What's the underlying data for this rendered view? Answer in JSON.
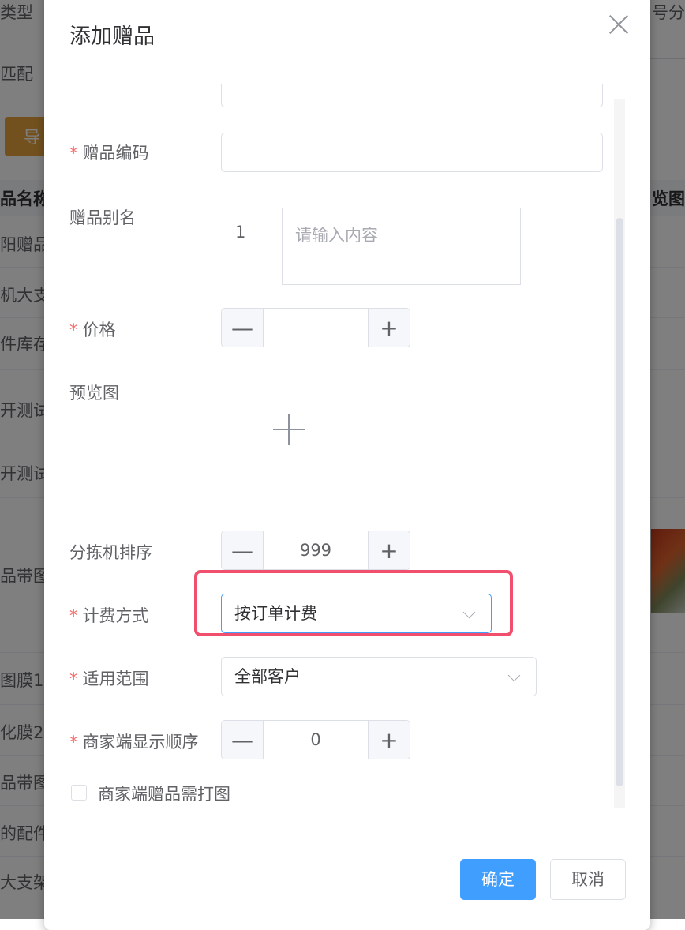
{
  "background": {
    "filter_label_type": "类型",
    "filter_label_match": "匹配",
    "filter_label_right": "号分",
    "export_button": "导",
    "col_name_header": "品名称",
    "col_preview_header": "览图",
    "rows": [
      "阳赠品",
      "机大支",
      "件库存",
      "开测试",
      "开测试",
      "品带图",
      "图膜1",
      "化膜2",
      "品带图",
      "的配件",
      "大支架"
    ]
  },
  "dialog": {
    "title": "添加赠品",
    "fields": {
      "code": {
        "label": "赠品编码",
        "value": ""
      },
      "alias": {
        "label": "赠品别名",
        "index": "1",
        "placeholder": "请输入内容"
      },
      "price": {
        "label": "价格",
        "value": ""
      },
      "preview": {
        "label": "预览图"
      },
      "sort_order": {
        "label": "分拣机排序",
        "value": "999"
      },
      "billing": {
        "label": "计费方式",
        "value": "按订单计费"
      },
      "scope": {
        "label": "适用范围",
        "value": "全部客户"
      },
      "merchant_order": {
        "label": "商家端显示顺序",
        "value": "0"
      },
      "need_print": {
        "label": "商家端赠品需打图",
        "checked": false
      }
    },
    "stepper_minus": "—",
    "stepper_plus": "+",
    "confirm_label": "确定",
    "cancel_label": "取消"
  },
  "colors": {
    "primary": "#409eff",
    "required_star": "#f56c6c",
    "highlight_box": "#f0506e"
  },
  "icons": [
    "close-icon",
    "plus-icon",
    "chevron-down-icon",
    "minus-icon"
  ]
}
